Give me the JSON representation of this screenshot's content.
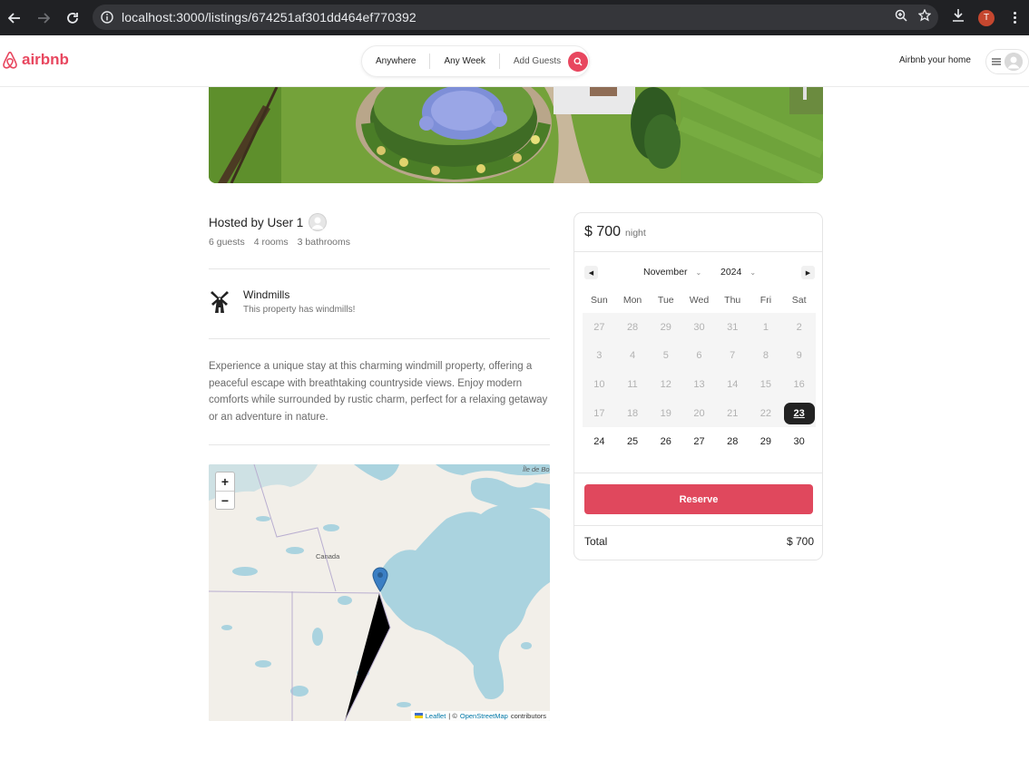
{
  "browser": {
    "url": "localhost:3000/listings/674251af301dd464ef770392",
    "profile_initial": "T"
  },
  "header": {
    "brand": "airbnb",
    "search": {
      "where": "Anywhere",
      "when": "Any Week",
      "guests": "Add Guests"
    },
    "host_link": "Airbnb your home"
  },
  "listing": {
    "hosted_by": "Hosted by User 1",
    "stats": [
      "6 guests",
      "4 rooms",
      "3 bathrooms"
    ],
    "amenity": {
      "title": "Windmills",
      "description": "This property has windmills!"
    },
    "description": "Experience a unique stay at this charming windmill property, offering a peaceful escape with breathtaking countryside views. Enjoy modern comforts while surrounded by rustic charm, perfect for a relaxing getaway or an adventure in nature."
  },
  "map": {
    "zoom_in": "+",
    "zoom_out": "−",
    "label_country": "Canada",
    "label_island": "Île de Bo",
    "attribution": {
      "leaflet": "Leaflet",
      "sep": "| ©",
      "osm": "OpenStreetMap",
      "contributors": "contributors"
    }
  },
  "booking": {
    "price": "$ 700",
    "price_unit": "night",
    "calendar": {
      "month": "November",
      "year": "2024",
      "weekdays": [
        "Sun",
        "Mon",
        "Tue",
        "Wed",
        "Thu",
        "Fri",
        "Sat"
      ],
      "days": [
        {
          "d": "27",
          "s": "disabled"
        },
        {
          "d": "28",
          "s": "disabled"
        },
        {
          "d": "29",
          "s": "disabled"
        },
        {
          "d": "30",
          "s": "disabled"
        },
        {
          "d": "31",
          "s": "disabled"
        },
        {
          "d": "1",
          "s": "disabled"
        },
        {
          "d": "2",
          "s": "disabled"
        },
        {
          "d": "3",
          "s": "disabled"
        },
        {
          "d": "4",
          "s": "disabled"
        },
        {
          "d": "5",
          "s": "disabled"
        },
        {
          "d": "6",
          "s": "disabled"
        },
        {
          "d": "7",
          "s": "disabled"
        },
        {
          "d": "8",
          "s": "disabled"
        },
        {
          "d": "9",
          "s": "disabled"
        },
        {
          "d": "10",
          "s": "disabled"
        },
        {
          "d": "11",
          "s": "disabled"
        },
        {
          "d": "12",
          "s": "disabled"
        },
        {
          "d": "13",
          "s": "disabled"
        },
        {
          "d": "14",
          "s": "disabled"
        },
        {
          "d": "15",
          "s": "disabled"
        },
        {
          "d": "16",
          "s": "disabled"
        },
        {
          "d": "17",
          "s": "disabled"
        },
        {
          "d": "18",
          "s": "disabled"
        },
        {
          "d": "19",
          "s": "disabled"
        },
        {
          "d": "20",
          "s": "disabled"
        },
        {
          "d": "21",
          "s": "disabled"
        },
        {
          "d": "22",
          "s": "disabled"
        },
        {
          "d": "23",
          "s": "today"
        },
        {
          "d": "24",
          "s": "active"
        },
        {
          "d": "25",
          "s": "active"
        },
        {
          "d": "26",
          "s": "active"
        },
        {
          "d": "27",
          "s": "active"
        },
        {
          "d": "28",
          "s": "active"
        },
        {
          "d": "29",
          "s": "active"
        },
        {
          "d": "30",
          "s": "active"
        }
      ]
    },
    "reserve_label": "Reserve",
    "total_label": "Total",
    "total_value": "$ 700"
  },
  "colors": {
    "brand": "#e8475f",
    "reserve": "#e0485d",
    "map_water": "#aad3df",
    "map_land": "#f2efe9"
  }
}
